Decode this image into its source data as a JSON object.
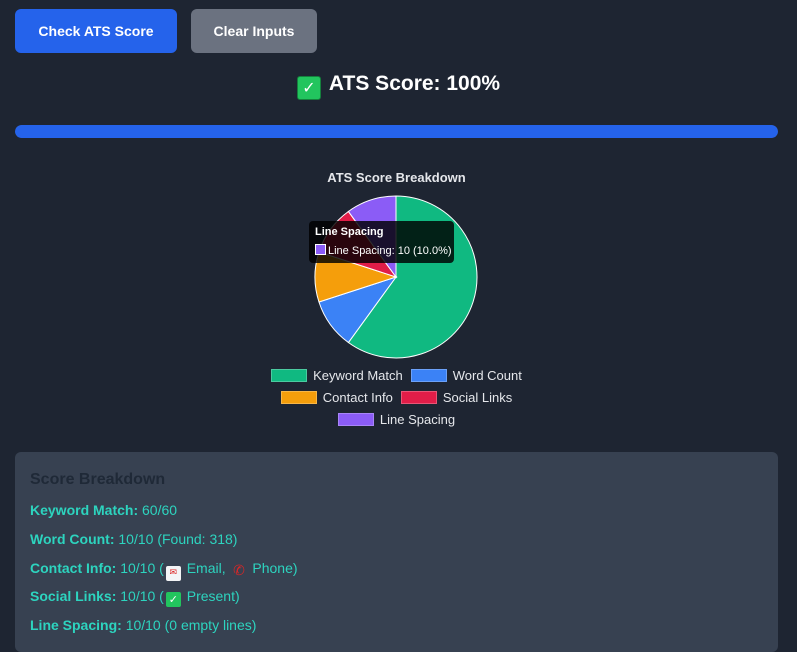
{
  "buttons": {
    "check_label": "Check ATS Score",
    "clear_label": "Clear Inputs"
  },
  "score": {
    "icon": "check-mark-icon",
    "text": "ATS Score: 100%",
    "progress_percent": 100,
    "progress_color": "#2563eb"
  },
  "chart_data": {
    "type": "pie",
    "title": "ATS Score Breakdown",
    "categories": [
      "Keyword Match",
      "Word Count",
      "Contact Info",
      "Social Links",
      "Line Spacing"
    ],
    "values": [
      60,
      10,
      10,
      10,
      10
    ],
    "colors": [
      "#10b981",
      "#3b82f6",
      "#f59e0b",
      "#e11d48",
      "#8b5cf6"
    ],
    "legend_position": "bottom",
    "tooltip": {
      "title": "Line Spacing",
      "body": "Line Spacing: 10 (10.0%)"
    }
  },
  "breakdown": {
    "title": "Score Breakdown",
    "rows": [
      {
        "label": "Keyword Match:",
        "value": "60/60"
      },
      {
        "label": "Word Count:",
        "value": "10/10 (Found: 318)"
      },
      {
        "label": "Contact Info:",
        "value_prefix": "10/10 (",
        "email": "Email,",
        "phone": "Phone)"
      },
      {
        "label": "Social Links:",
        "value_prefix": "10/10 (",
        "value_suffix": "Present)"
      },
      {
        "label": "Line Spacing:",
        "value": "10/10 (0 empty lines)"
      }
    ]
  }
}
